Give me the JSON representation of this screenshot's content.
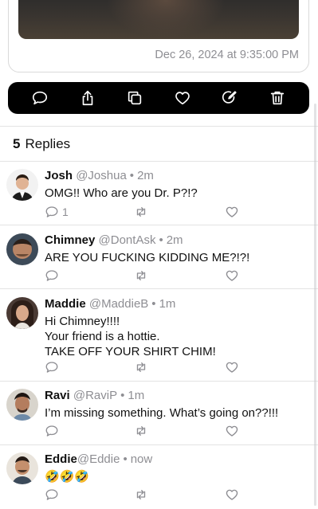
{
  "post": {
    "timestamp": "Dec 26, 2024 at 9:35:00 PM"
  },
  "action_bar": {
    "icons": [
      "comment-icon",
      "share-icon",
      "copy-icon",
      "heart-icon",
      "edit-icon",
      "trash-icon"
    ]
  },
  "replies_header": {
    "count": "5",
    "label": "Replies"
  },
  "replies": [
    {
      "name": "Josh",
      "handle": "@Joshua",
      "time": "2m",
      "lines": [
        "OMG!! Who are you Dr. P?!?"
      ],
      "reply_count": "1"
    },
    {
      "name": "Chimney",
      "handle": "@DontAsk",
      "time": "2m",
      "lines": [
        "ARE YOU FUCKING KIDDING ME?!?!"
      ],
      "reply_count": ""
    },
    {
      "name": "Maddie",
      "handle": "@MaddieB",
      "time": "1m",
      "lines": [
        "Hi Chimney!!!!",
        "Your friend is a hottie.",
        "TAKE OFF YOUR SHIRT CHIM!"
      ],
      "reply_count": ""
    },
    {
      "name": "Ravi",
      "handle": "@RaviP",
      "time": "1m",
      "lines": [
        "I’m missing something. What’s going on??!!!"
      ],
      "reply_count": ""
    },
    {
      "name": "Eddie",
      "handle": "@Eddie",
      "time": "now",
      "lines": [
        "🤣🤣🤣"
      ],
      "reply_count": ""
    }
  ],
  "colors": {
    "action_bar_bg": "#000000",
    "secondary_text": "#8e8e93",
    "divider": "#e3e3e3"
  }
}
